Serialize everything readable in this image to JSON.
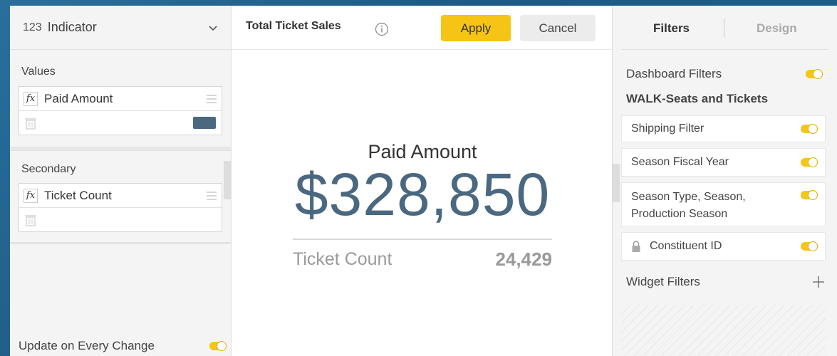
{
  "left_panel": {
    "indicator_number": "123",
    "indicator_label": "Indicator",
    "values_label": "Values",
    "values_field": "Paid Amount",
    "secondary_label": "Secondary",
    "secondary_field": "Ticket Count",
    "update_label": "Update on Every Change",
    "swatch_color": "#4a6880"
  },
  "toolbar": {
    "title": "Total Ticket Sales",
    "apply_label": "Apply",
    "cancel_label": "Cancel"
  },
  "widget": {
    "label": "Paid Amount",
    "value": "$328,850",
    "secondary_label": "Ticket Count",
    "secondary_value": "24,429",
    "value_color": "#4a6880"
  },
  "right_panel": {
    "tab_filters": "Filters",
    "tab_design": "Design",
    "dashboard_filters_label": "Dashboard Filters",
    "data_source": "WALK-Seats and Tickets",
    "filters": [
      {
        "label": "Shipping Filter"
      },
      {
        "label": "Season Fiscal Year"
      },
      {
        "label_line1": "Season Type, Season,",
        "label_line2": "Production Season"
      },
      {
        "label": "Constituent ID"
      }
    ],
    "widget_filters_label": "Widget Filters"
  },
  "colors": {
    "accent_yellow": "#f6c414",
    "toggle_on": "#f5c518"
  }
}
